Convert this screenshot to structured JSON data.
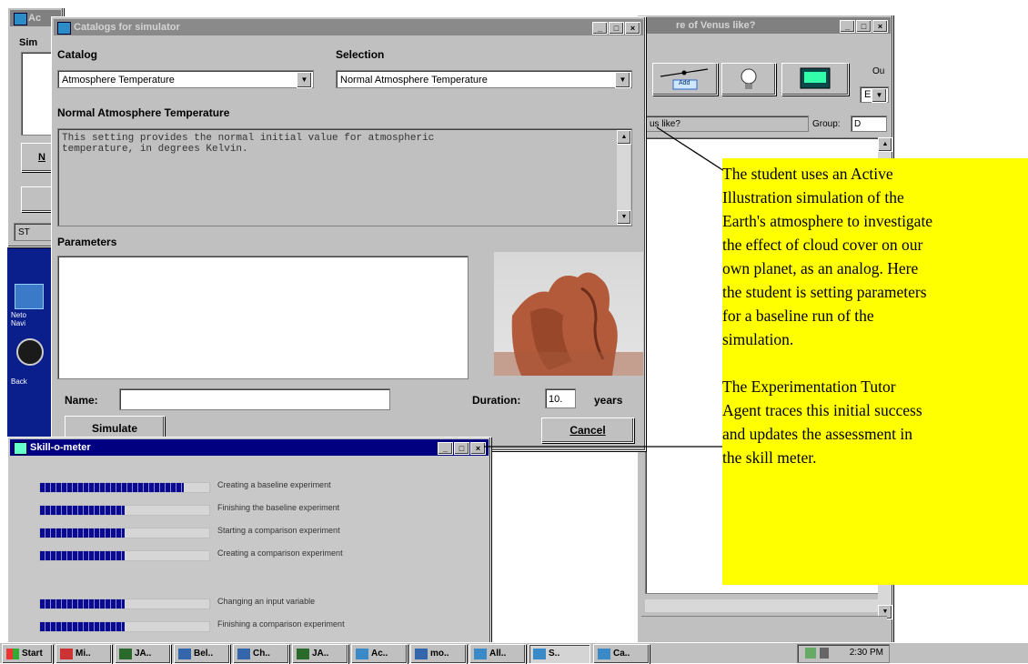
{
  "background_windows": {
    "main_title": "Ac",
    "main_label": "Sim",
    "main_button_n": "N",
    "main_status": "ST",
    "venus_title": "re of Venus like?",
    "venus_question": "us like?",
    "venus_group_label": "Group:",
    "venus_group_value": "D",
    "venus_side_label": "Ou",
    "venus_side_select": "E",
    "venus_button_label": "Add"
  },
  "desktop_icons": [
    {
      "label": "Neto\nNavi",
      "icon": "network-neighborhood-icon"
    },
    {
      "label": "Back",
      "icon": "backup-icon"
    }
  ],
  "catalog_dialog": {
    "title": "Catalogs for simulator",
    "catalog_label": "Catalog",
    "catalog_value": "Atmosphere Temperature",
    "selection_label": "Selection",
    "selection_value": "Normal Atmosphere Temperature",
    "heading": "Normal Atmosphere Temperature",
    "description": "This setting provides the normal initial value for atmospheric\ntemperature, in degrees Kelvin.",
    "parameters_label": "Parameters",
    "name_label": "Name:",
    "name_value": "",
    "duration_label": "Duration:",
    "duration_value": "10.",
    "duration_unit": "years",
    "simulate_button": "Simulate",
    "cancel_button": "Cancel"
  },
  "skill_meter": {
    "title": "Skill-o-meter",
    "skills": [
      {
        "label": "Creating a baseline experiment",
        "level": 0.85
      },
      {
        "label": "Finishing the baseline experiment",
        "level": 0.5
      },
      {
        "label": "Starting a comparison experiment",
        "level": 0.5
      },
      {
        "label": "Creating a comparison experiment",
        "level": 0.5
      },
      {
        "label": "Changing an input variable",
        "level": 0.5
      },
      {
        "label": "Finishing a comparison experiment",
        "level": 0.5
      }
    ]
  },
  "annotation": {
    "paragraph1": "The student uses an Active\nIllustration simulation of the\nEarth's atmosphere to investigate\nthe effect of cloud cover on our\nown planet, as an analog.  Here\nthe student is setting parameters\nfor a baseline run of the\nsimulation.",
    "paragraph2": "The Experimentation Tutor\nAgent traces this initial success\nand updates the assessment in\nthe skill meter."
  },
  "taskbar": {
    "start_label": "Start",
    "buttons": [
      "Mi..",
      "JA..",
      "Bel..",
      "Ch..",
      "JA..",
      "Ac..",
      "mo..",
      "All..",
      "S..",
      "Ca.."
    ],
    "clock": "2:30 PM"
  },
  "colors": {
    "title_active": "#000080",
    "title_inactive": "#808080",
    "window_face": "#c0c0c0",
    "annotation_bg": "#ffff00",
    "desktop": "#0a1e8c"
  }
}
